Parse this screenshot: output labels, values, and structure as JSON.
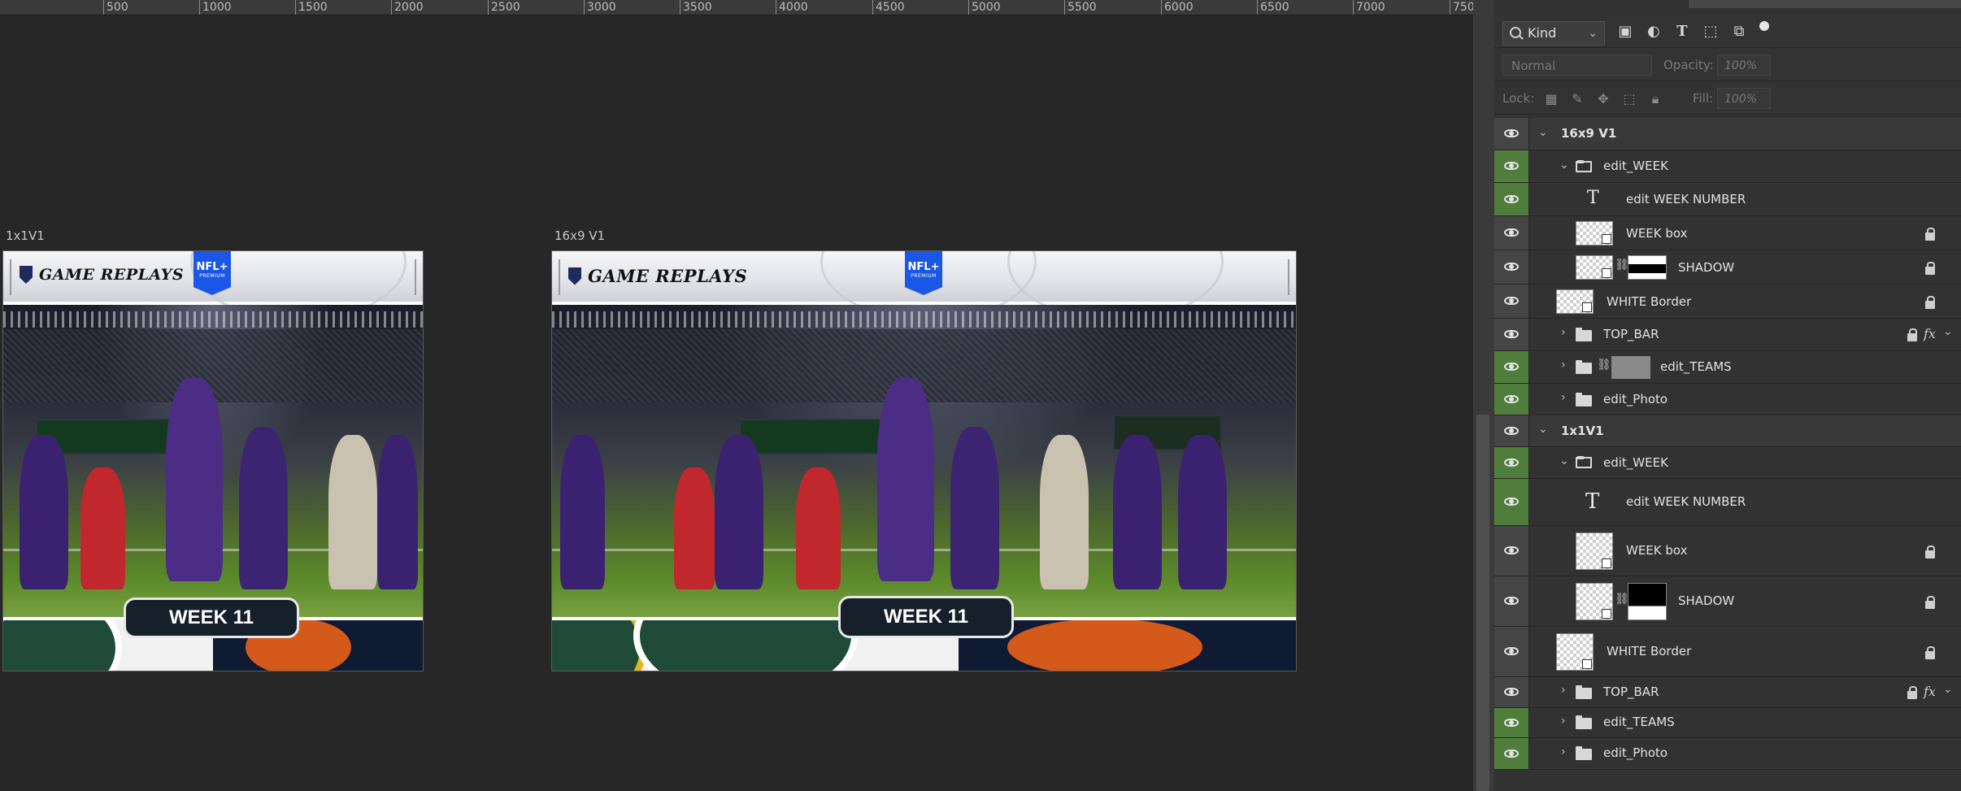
{
  "ruler": {
    "ticks": [
      "500",
      "1000",
      "1500",
      "2000",
      "2500",
      "3000",
      "3500",
      "4000",
      "4500",
      "5000",
      "5500",
      "6000",
      "6500",
      "7000",
      "750"
    ]
  },
  "artboards": [
    {
      "label": "1x1V1",
      "brand": "GAME REPLAYS",
      "badge_top": "NFL+",
      "badge_bottom": "PREMIUM",
      "week": "WEEK 11"
    },
    {
      "label": "16x9 V1",
      "brand": "GAME REPLAYS",
      "badge_top": "NFL+",
      "badge_bottom": "PREMIUM",
      "week": "WEEK 11"
    }
  ],
  "panel": {
    "filter": {
      "kind": "Kind",
      "icons": [
        "image-filter-icon",
        "adjustment-filter-icon",
        "type-filter-icon",
        "shape-filter-icon",
        "smart-object-filter-icon",
        "filter-toggle-icon"
      ]
    },
    "blend": {
      "mode": "Normal",
      "opacity_label": "Opacity:",
      "opacity_value": "100%"
    },
    "lock": {
      "label": "Lock:",
      "fill_label": "Fill:",
      "fill_value": "100%"
    }
  },
  "layers": [
    {
      "name": "16x9 V1",
      "type": "artboard",
      "visible_highlight": false
    },
    {
      "name": "edit_WEEK",
      "type": "folder-open",
      "visible_highlight": true
    },
    {
      "name": "edit WEEK NUMBER",
      "type": "text",
      "visible_highlight": true
    },
    {
      "name": "WEEK box",
      "type": "smart",
      "visible_highlight": false,
      "locked": true
    },
    {
      "name": "SHADOW",
      "type": "smart-mask",
      "visible_highlight": false,
      "locked": true
    },
    {
      "name": "WHITE Border",
      "type": "smart",
      "visible_highlight": false,
      "locked": true
    },
    {
      "name": "TOP_BAR",
      "type": "folder",
      "visible_highlight": false,
      "locked": true,
      "fx": "fx"
    },
    {
      "name": "edit_TEAMS",
      "type": "folder-mask",
      "visible_highlight": true
    },
    {
      "name": "edit_Photo",
      "type": "folder",
      "visible_highlight": true
    },
    {
      "name": "1x1V1",
      "type": "artboard",
      "visible_highlight": false
    },
    {
      "name": "edit_WEEK",
      "type": "folder-open",
      "visible_highlight": true
    },
    {
      "name": "edit WEEK NUMBER",
      "type": "text",
      "visible_highlight": true
    },
    {
      "name": "WEEK box",
      "type": "smart",
      "visible_highlight": false,
      "locked": true
    },
    {
      "name": "SHADOW",
      "type": "smart-mask",
      "visible_highlight": false,
      "locked": true
    },
    {
      "name": "WHITE Border",
      "type": "smart",
      "visible_highlight": false,
      "locked": true
    },
    {
      "name": "TOP_BAR",
      "type": "folder",
      "visible_highlight": false,
      "locked": true,
      "fx": "fx"
    },
    {
      "name": "edit_TEAMS",
      "type": "folder",
      "visible_highlight": true
    },
    {
      "name": "edit_Photo",
      "type": "folder",
      "visible_highlight": true
    }
  ],
  "colors": {
    "visibility_on": "#4f7d3c",
    "nfl_blue": "#1b57e6",
    "chicago_orange": "#d45a1c",
    "green_bay": "#1f4a37"
  }
}
